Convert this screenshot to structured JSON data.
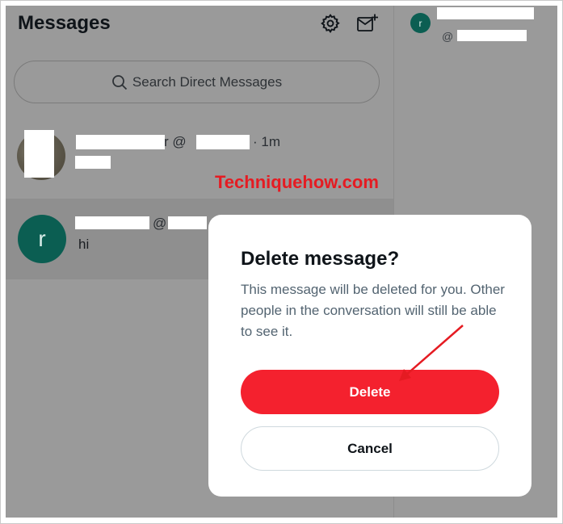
{
  "page": {
    "title": "Messages"
  },
  "search": {
    "placeholder": "Search Direct Messages"
  },
  "conversations": [
    {
      "handle_prefix": "r @",
      "time": "· 1m",
      "avatar_letter": ""
    },
    {
      "handle_prefix": "@",
      "message": "hi",
      "avatar_letter": "r"
    }
  ],
  "right_panel": {
    "avatar_letter": "r",
    "handle_prefix": "@"
  },
  "watermark": "Techniquehow.com",
  "dialog": {
    "title": "Delete message?",
    "body": "This message will be deleted for you. Other people in the conversation will still be able to see it.",
    "delete_label": "Delete",
    "cancel_label": "Cancel"
  },
  "colors": {
    "delete_button": "#f4212e",
    "avatar": "#0b5e52",
    "overlay": "#9a9a9a",
    "watermark": "#e51b22"
  }
}
